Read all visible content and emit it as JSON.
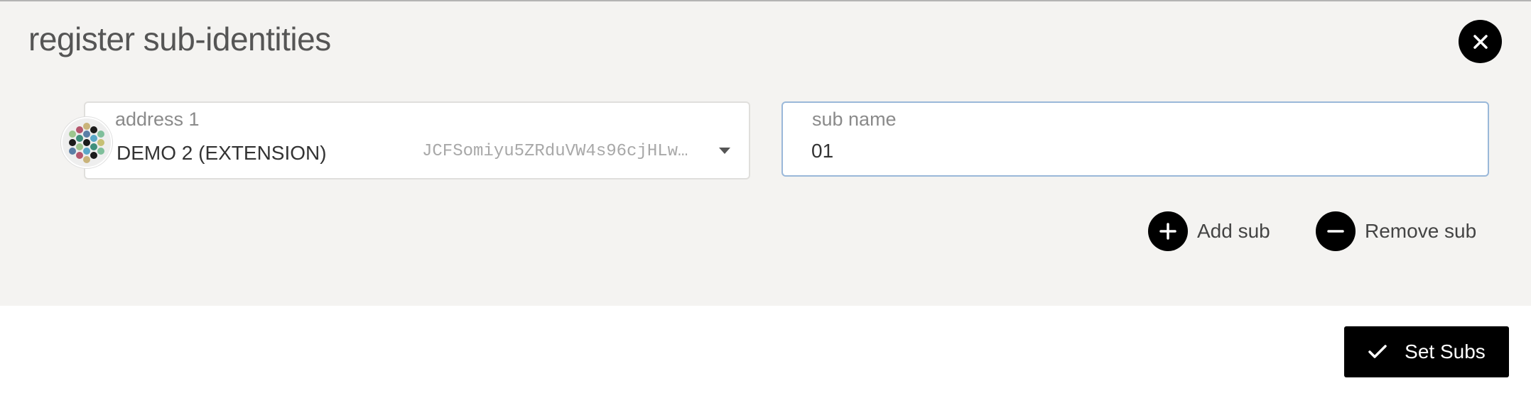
{
  "modal": {
    "title": "register sub-identities",
    "close_icon": "close-icon"
  },
  "address_field": {
    "label": "address 1",
    "account_name": "DEMO 2 (EXTENSION)",
    "account_address": "JCFSomiyu5ZRduVW4s96cjHLw…",
    "icon": "identicon"
  },
  "sub_name_field": {
    "label": "sub name",
    "value": "01"
  },
  "actions": {
    "add_label": "Add sub",
    "add_icon": "plus-icon",
    "remove_label": "Remove sub",
    "remove_icon": "minus-icon"
  },
  "footer": {
    "submit_label": "Set Subs",
    "submit_icon": "check-icon"
  },
  "colors": {
    "body_background": "#f4f3f1",
    "button_background": "#000000",
    "input_focus_border": "#9ab8d9"
  }
}
